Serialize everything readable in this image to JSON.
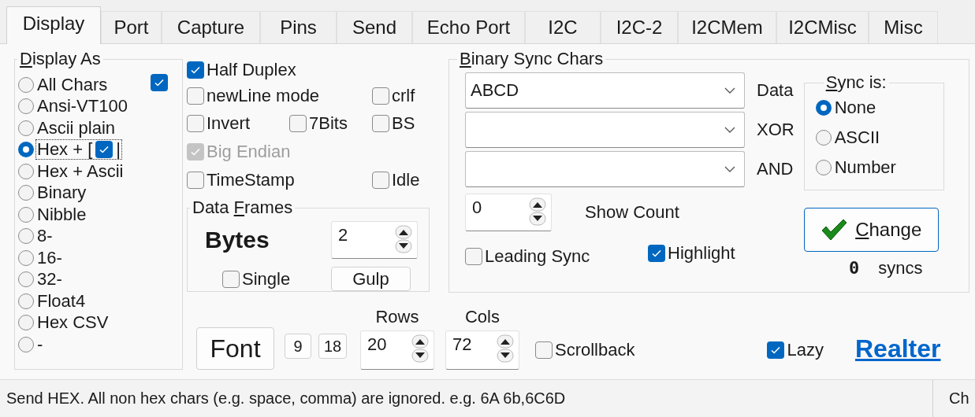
{
  "tabs": [
    {
      "label": "Display",
      "selected": true
    },
    {
      "label": "Port",
      "selected": false
    },
    {
      "label": "Capture",
      "selected": false
    },
    {
      "label": "Pins",
      "selected": false
    },
    {
      "label": "Send",
      "selected": false
    },
    {
      "label": "Echo Port",
      "selected": false
    },
    {
      "label": "I2C",
      "selected": false
    },
    {
      "label": "I2C-2",
      "selected": false
    },
    {
      "label": "I2CMem",
      "selected": false
    },
    {
      "label": "I2CMisc",
      "selected": false
    },
    {
      "label": "Misc",
      "selected": false
    }
  ],
  "display_as": {
    "title": {
      "key": "D",
      "after": "isplay As"
    },
    "corner_checkbox": {
      "checked": true
    },
    "options": [
      {
        "kind": "plain",
        "label": "All Chars",
        "selected": false
      },
      {
        "kind": "plain",
        "label": "Ansi-VT100",
        "selected": false
      },
      {
        "kind": "plain",
        "label": "Ascii plain",
        "selected": false
      },
      {
        "kind": "overlaid",
        "label": "Hex + [",
        "tail": "|",
        "overlay_checked": true,
        "focused": true,
        "selected": true
      },
      {
        "kind": "plain",
        "label": "Hex + Ascii",
        "selected": false
      },
      {
        "kind": "plain",
        "label": "Binary",
        "selected": false
      },
      {
        "kind": "plain",
        "label": "Nibble",
        "selected": false
      },
      {
        "kind": "plain",
        "label": "8-",
        "selected": false
      },
      {
        "kind": "plain",
        "label": "16-",
        "selected": false
      },
      {
        "kind": "plain",
        "label": "32-",
        "selected": false
      },
      {
        "kind": "plain",
        "label": "Float4",
        "selected": false
      },
      {
        "kind": "plain",
        "label": "Hex CSV",
        "selected": false
      },
      {
        "kind": "plain",
        "label": "-",
        "selected": false
      }
    ]
  },
  "options": [
    {
      "left": {
        "label": "Half Duplex",
        "checked": true
      }
    },
    {
      "left": {
        "label": "newLine mode",
        "checked": false
      },
      "right": {
        "label": "crlf",
        "checked": false
      }
    },
    {
      "left": {
        "label": "Invert",
        "checked": false
      },
      "middle": {
        "label": "7Bits",
        "checked": false
      },
      "right": {
        "label": "BS",
        "checked": false
      }
    },
    {
      "left": {
        "label": "Big Endian",
        "checked": true,
        "disabled": true
      }
    },
    {
      "left": {
        "label": "TimeStamp",
        "checked": false
      },
      "right": {
        "label": "Idle",
        "checked": false
      }
    }
  ],
  "data_frames": {
    "title": {
      "before": "Data ",
      "key": "F",
      "after": "rames"
    },
    "unit": "Bytes",
    "count": "2",
    "single": {
      "label": "Single",
      "checked": false
    },
    "button": "Gulp"
  },
  "binary_sync": {
    "title": {
      "key": "B",
      "after": "inary Sync Chars"
    },
    "combos": [
      {
        "value": "ABCD",
        "label": "Data"
      },
      {
        "label": "XOR"
      },
      {
        "label": "AND"
      }
    ],
    "sync_is": {
      "title": {
        "key": "S",
        "after": "ync is:"
      },
      "options": [
        {
          "label": "None",
          "selected": true
        },
        {
          "label": "ASCII",
          "selected": false
        },
        {
          "label": "Number",
          "selected": false
        }
      ]
    },
    "show_count": {
      "value": "0",
      "label": "Show Count"
    },
    "change_button": {
      "key": "C",
      "after": "hange"
    },
    "leading_sync": {
      "label": "Leading Sync",
      "checked": false
    },
    "highlight": {
      "label": "Highlight",
      "checked": true
    },
    "sync_count": {
      "value": "0",
      "unit": "syncs"
    }
  },
  "bottom": {
    "font_button": "Font",
    "size_buttons": [
      "9",
      "18"
    ],
    "rows": {
      "label": "Rows",
      "value": "20"
    },
    "cols": {
      "label": "Cols",
      "value": "72"
    },
    "scrollback": {
      "label": "Scrollback",
      "checked": false
    },
    "lazy": {
      "label": "Lazy",
      "checked": true
    },
    "link": "Realter"
  },
  "status_bar": {
    "message": "Send HEX. All non hex chars (e.g. space, comma) are ignored. e.g. 6A 6b,6C6D",
    "panel": "Ch"
  }
}
